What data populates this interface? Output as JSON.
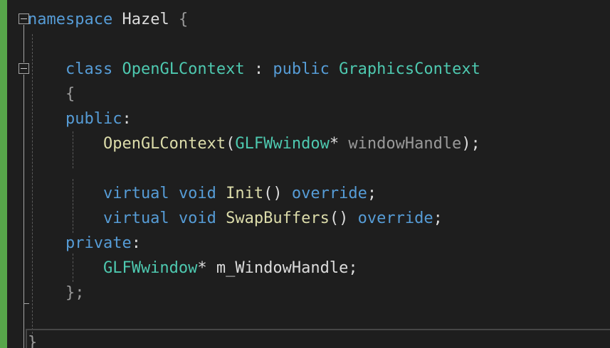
{
  "editor": {
    "colors": {
      "background": "#1e1e1e",
      "change_bar": "#57a64a",
      "keyword": "#569cd6",
      "type": "#4ec9b0",
      "function": "#dcdcaa",
      "parameter": "#9a9a9a",
      "plain": "#dcdcdc"
    },
    "lines": [
      [
        {
          "text": "namespace",
          "kind": "keyword"
        },
        {
          "text": " Hazel ",
          "kind": "plain"
        },
        {
          "text": "{",
          "kind": "parameter"
        }
      ],
      [],
      [
        {
          "text": "    class",
          "kind": "keyword"
        },
        {
          "text": " OpenGLContext ",
          "kind": "type"
        },
        {
          "text": ": ",
          "kind": "plain"
        },
        {
          "text": "public",
          "kind": "keyword"
        },
        {
          "text": " GraphicsContext",
          "kind": "type"
        }
      ],
      [
        {
          "text": "    {",
          "kind": "parameter"
        }
      ],
      [
        {
          "text": "    public",
          "kind": "keyword"
        },
        {
          "text": ":",
          "kind": "plain"
        }
      ],
      [
        {
          "text": "        OpenGLContext",
          "kind": "function"
        },
        {
          "text": "(",
          "kind": "plain"
        },
        {
          "text": "GLFWwindow",
          "kind": "type"
        },
        {
          "text": "* ",
          "kind": "plain"
        },
        {
          "text": "windowHandle",
          "kind": "parameter"
        },
        {
          "text": ");",
          "kind": "plain"
        }
      ],
      [],
      [
        {
          "text": "        virtual",
          "kind": "keyword"
        },
        {
          "text": " ",
          "kind": "plain"
        },
        {
          "text": "void",
          "kind": "keyword"
        },
        {
          "text": " ",
          "kind": "plain"
        },
        {
          "text": "Init",
          "kind": "function"
        },
        {
          "text": "() ",
          "kind": "plain"
        },
        {
          "text": "override",
          "kind": "keyword"
        },
        {
          "text": ";",
          "kind": "plain"
        }
      ],
      [
        {
          "text": "        virtual",
          "kind": "keyword"
        },
        {
          "text": " ",
          "kind": "plain"
        },
        {
          "text": "void",
          "kind": "keyword"
        },
        {
          "text": " ",
          "kind": "plain"
        },
        {
          "text": "SwapBuffers",
          "kind": "function"
        },
        {
          "text": "() ",
          "kind": "plain"
        },
        {
          "text": "override",
          "kind": "keyword"
        },
        {
          "text": ";",
          "kind": "plain"
        }
      ],
      [
        {
          "text": "    private",
          "kind": "keyword"
        },
        {
          "text": ":",
          "kind": "plain"
        }
      ],
      [
        {
          "text": "        GLFWwindow",
          "kind": "type"
        },
        {
          "text": "* m_WindowHandle;",
          "kind": "plain"
        }
      ],
      [
        {
          "text": "    };",
          "kind": "parameter"
        }
      ],
      [],
      [
        {
          "text": "}",
          "kind": "parameter"
        }
      ]
    ]
  }
}
